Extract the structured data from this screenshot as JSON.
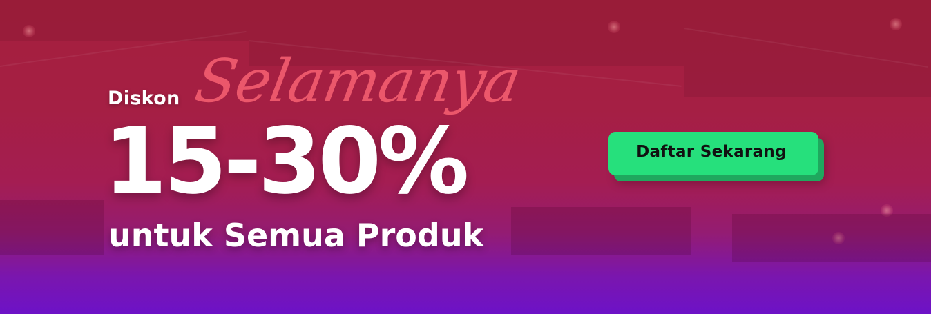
{
  "promo": {
    "prefix": "Diskon",
    "script_word": "Selamanya",
    "discount_range": "15-30%",
    "subtitle": "untuk Semua Produk"
  },
  "cta": {
    "label": "Daftar Sekarang"
  },
  "colors": {
    "background_top": "#a51f3d",
    "background_bottom": "#6d12c7",
    "script_text": "#ef5b6e",
    "cta_fill": "#26e07c",
    "cta_shadow": "#1fa85e"
  }
}
